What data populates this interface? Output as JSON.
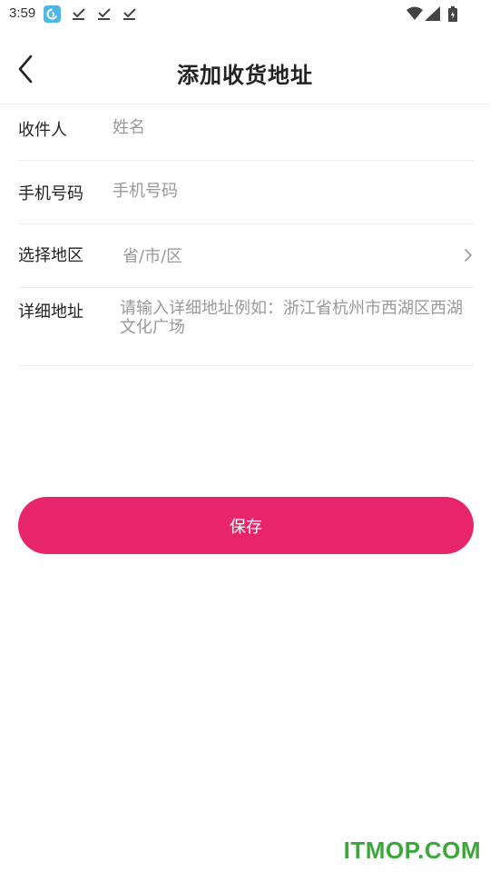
{
  "status_bar": {
    "time": "3:59"
  },
  "header": {
    "title": "添加收货地址"
  },
  "form": {
    "recipient": {
      "label": "收件人",
      "placeholder": "姓名"
    },
    "phone": {
      "label": "手机号码",
      "placeholder": "手机号码"
    },
    "region": {
      "label": "选择地区",
      "placeholder": "省/市/区"
    },
    "address": {
      "label": "详细地址",
      "placeholder": "请输入详细地址例如：浙江省杭州市西湖区西湖文化广场"
    }
  },
  "actions": {
    "save_label": "保存"
  },
  "colors": {
    "accent": "#e8246a",
    "watermark": "#3aa83a"
  },
  "watermark": "ITMOP.COM"
}
